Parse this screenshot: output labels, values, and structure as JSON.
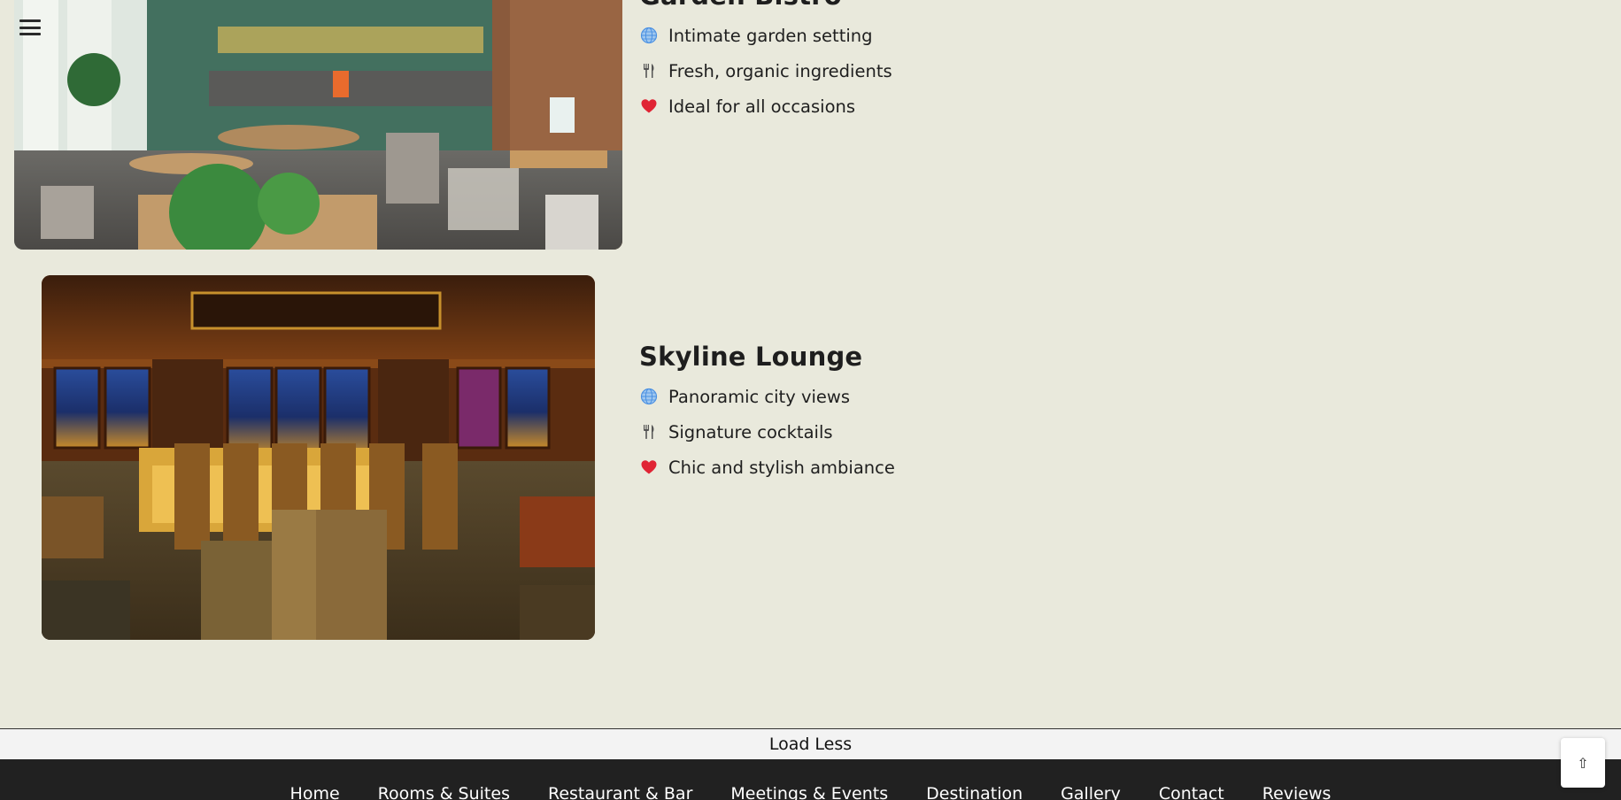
{
  "menu": {
    "icon": "hamburger-menu-icon"
  },
  "venues": [
    {
      "title": "Garden Bistro",
      "image_subject": "garden bistro dining room",
      "features": [
        {
          "icon": "globe-icon",
          "text": "Intimate garden setting"
        },
        {
          "icon": "fork-knife-icon",
          "text": "Fresh, organic ingredients"
        },
        {
          "icon": "heart-icon",
          "text": "Ideal for all occasions"
        }
      ]
    },
    {
      "title": "Skyline Lounge",
      "image_subject": "skyline lounge bar with city view",
      "features": [
        {
          "icon": "globe-icon",
          "text": "Panoramic city views"
        },
        {
          "icon": "fork-knife-icon",
          "text": "Signature cocktails"
        },
        {
          "icon": "heart-icon",
          "text": "Chic and stylish ambiance"
        }
      ]
    }
  ],
  "load_less_label": "Load Less",
  "footer_nav": [
    "Home",
    "Rooms & Suites",
    "Restaurant & Bar",
    "Meetings & Events",
    "Destination",
    "Gallery",
    "Contact",
    "Reviews"
  ],
  "back_to_top": {
    "icon": "arrow-up-icon",
    "glyph": "⇧"
  },
  "colors": {
    "page_bg": "#e9e9dc",
    "footer_bg": "#212121",
    "globe": "#4a90e2",
    "fork": "#555555",
    "heart": "#e02434"
  }
}
